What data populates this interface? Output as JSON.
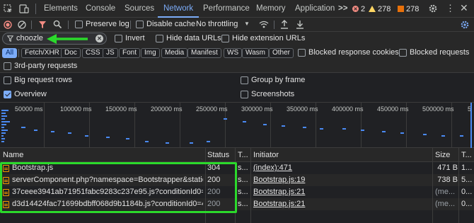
{
  "tabs": [
    {
      "label": "Elements"
    },
    {
      "label": "Console"
    },
    {
      "label": "Sources"
    },
    {
      "label": "Network"
    },
    {
      "label": "Performance"
    },
    {
      "label": "Memory"
    },
    {
      "label": "Application"
    }
  ],
  "more_tabs": ">>",
  "badges": {
    "errors": "2",
    "warnings": "278",
    "issues": "278"
  },
  "toolbar": {
    "preserve_log": "Preserve log",
    "disable_cache": "Disable cache",
    "throttling": "No throttling"
  },
  "filter": {
    "value": "choozle",
    "invert": "Invert",
    "hide_data_urls": "Hide data URLs",
    "hide_extension_urls": "Hide extension URLs"
  },
  "type_filters": [
    "All",
    "Fetch/XHR",
    "Doc",
    "CSS",
    "JS",
    "Font",
    "Img",
    "Media",
    "Manifest",
    "WS",
    "Wasm",
    "Other"
  ],
  "blocked_response_cookies": "Blocked response cookies",
  "blocked_requests": "Blocked requests",
  "third_party": "3rd-party requests",
  "options": {
    "big_request_rows": "Big request rows",
    "group_by_frame": "Group by frame",
    "overview": "Overview",
    "screenshots": "Screenshots"
  },
  "overview_ticks": [
    "50000 ms",
    "100000 ms",
    "150000 ms",
    "200000 ms",
    "250000 ms",
    "300000 ms",
    "350000 ms",
    "400000 ms",
    "450000 ms",
    "500000 ms"
  ],
  "columns": {
    "name": "Name",
    "status": "Status",
    "type": "T...",
    "initiator": "Initiator",
    "size": "Size",
    "time": "T..."
  },
  "rows": [
    {
      "name": "Bootstrap.js",
      "status": "304",
      "type": "s...",
      "initiator": "(index):471",
      "size": "471 B",
      "time": "1..."
    },
    {
      "name": "serverComponent.php?namespace=Bootstrapper&staticJ...",
      "status": "200",
      "type": "s...",
      "initiator": "Bootstrap.js:19",
      "size": "738 B",
      "time": "5..."
    },
    {
      "name": "37ceee3941ab71951fabc9283c237e95.js?conditionId0=49...",
      "status": "200",
      "type": "s...",
      "initiator": "Bootstrap.js:21",
      "size": "(me...",
      "time": "0..."
    },
    {
      "name": "d3d14424fac71699bdbff068d9b1184b.js?conditionId0=42...",
      "status": "200",
      "type": "s...",
      "initiator": "Bootstrap.js:21",
      "size": "(me...",
      "time": "0..."
    }
  ]
}
